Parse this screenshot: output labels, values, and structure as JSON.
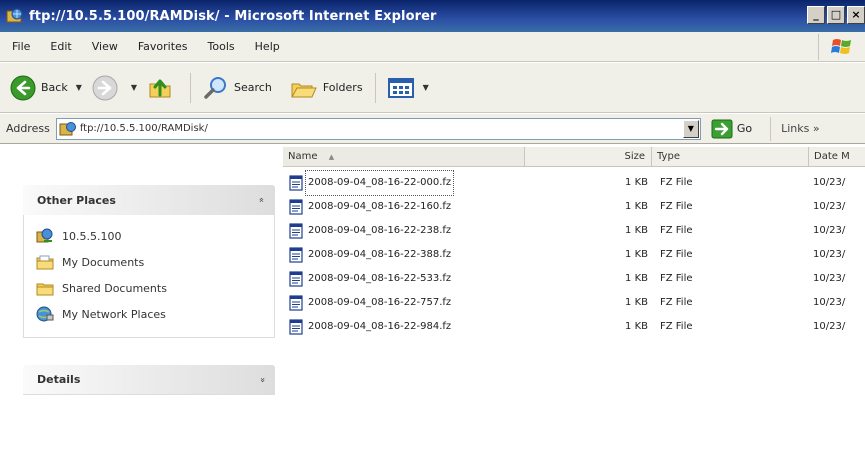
{
  "window": {
    "title": "ftp://10.5.5.100/RAMDisk/ - Microsoft Internet Explorer",
    "buttons": [
      "_",
      "□",
      "×"
    ]
  },
  "menu": {
    "items": [
      "File",
      "Edit",
      "View",
      "Favorites",
      "Tools",
      "Help"
    ]
  },
  "toolbar": {
    "back_label": "Back",
    "search_label": "Search",
    "folders_label": "Folders"
  },
  "address": {
    "label": "Address",
    "value": "ftp://10.5.5.100/RAMDisk/",
    "go_label": "Go",
    "links_label": "Links »"
  },
  "task_pane": {
    "other_places": {
      "title": "Other Places",
      "chevron": "»",
      "links": [
        "10.5.5.100",
        "My Documents",
        "Shared Documents",
        "My Network Places"
      ]
    },
    "details": {
      "title": "Details",
      "chevron": "»"
    }
  },
  "file_list": {
    "columns": {
      "name": "Name",
      "size": "Size",
      "type": "Type",
      "date": "Date M"
    },
    "sort_indicator": "▲",
    "rows": [
      {
        "name": "2008-09-04_08-16-22-000.fz",
        "size": "1 KB",
        "type": "FZ File",
        "date": "10/23/"
      },
      {
        "name": "2008-09-04_08-16-22-160.fz",
        "size": "1 KB",
        "type": "FZ File",
        "date": "10/23/"
      },
      {
        "name": "2008-09-04_08-16-22-238.fz",
        "size": "1 KB",
        "type": "FZ File",
        "date": "10/23/"
      },
      {
        "name": "2008-09-04_08-16-22-388.fz",
        "size": "1 KB",
        "type": "FZ File",
        "date": "10/23/"
      },
      {
        "name": "2008-09-04_08-16-22-533.fz",
        "size": "1 KB",
        "type": "FZ File",
        "date": "10/23/"
      },
      {
        "name": "2008-09-04_08-16-22-757.fz",
        "size": "1 KB",
        "type": "FZ File",
        "date": "10/23/"
      },
      {
        "name": "2008-09-04_08-16-22-984.fz",
        "size": "1 KB",
        "type": "FZ File",
        "date": "10/23/"
      }
    ]
  },
  "icons": {
    "app": "ie-ftp-icon",
    "back": "back-arrow-icon",
    "forward": "forward-arrow-icon",
    "up": "up-folder-icon",
    "search": "search-icon",
    "folders": "folders-icon",
    "views": "views-icon",
    "go": "go-arrow-icon",
    "file": "file-icon"
  },
  "colors": {
    "titlebar": "#0a246a",
    "chrome": "#f0efe8",
    "back_green": "#3a9a2a",
    "go_green": "#3aa032"
  }
}
